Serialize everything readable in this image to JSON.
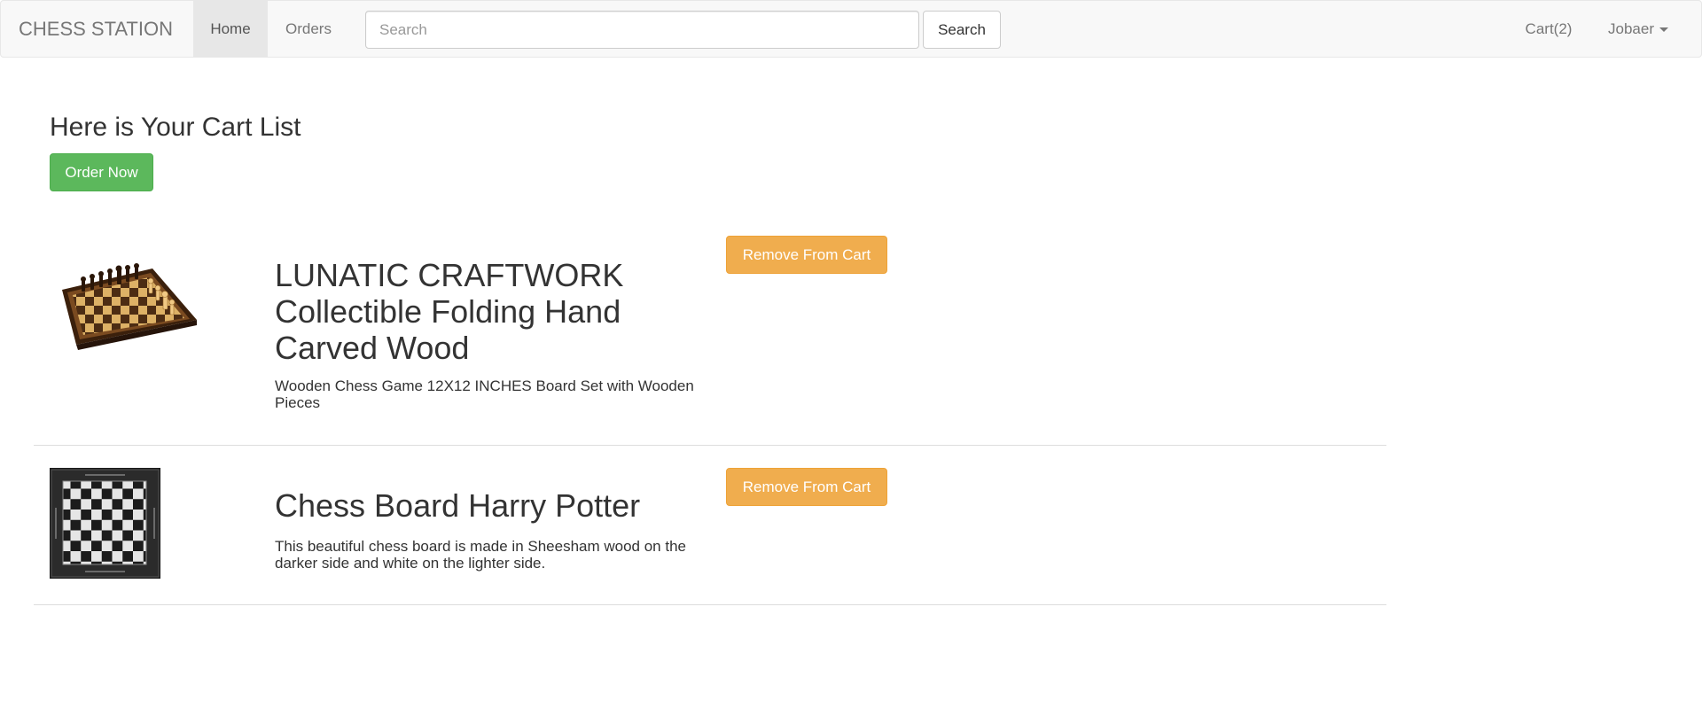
{
  "navbar": {
    "brand": "CHESS STATION",
    "links": [
      {
        "label": "Home"
      },
      {
        "label": "Orders"
      }
    ],
    "search": {
      "placeholder": "Search",
      "value": "",
      "button_label": "Search"
    },
    "cart_label": "Cart(2)",
    "user_label": "Jobaer"
  },
  "main": {
    "heading": "Here is Your Cart List",
    "order_button_label": "Order Now"
  },
  "cart_items": [
    {
      "title": "LUNATIC CRAFTWORK Collectible Folding Hand Carved Wood",
      "description": "Wooden Chess Game 12X12 INCHES Board Set with Wooden Pieces",
      "button_label": "Remove From Cart",
      "image_icon": "folding-wooden-chess-set-image"
    },
    {
      "title": "Chess Board Harry Potter",
      "description": "This beautiful chess board is made in Sheesham wood on the darker side and white on the lighter side.",
      "button_label": "Remove From Cart",
      "image_icon": "harry-potter-chess-board-image"
    }
  ],
  "colors": {
    "success": "#5cb85c",
    "warning": "#f0ad4e",
    "navbar_bg": "#f8f8f8",
    "active_tab_bg": "#e7e7e7"
  }
}
